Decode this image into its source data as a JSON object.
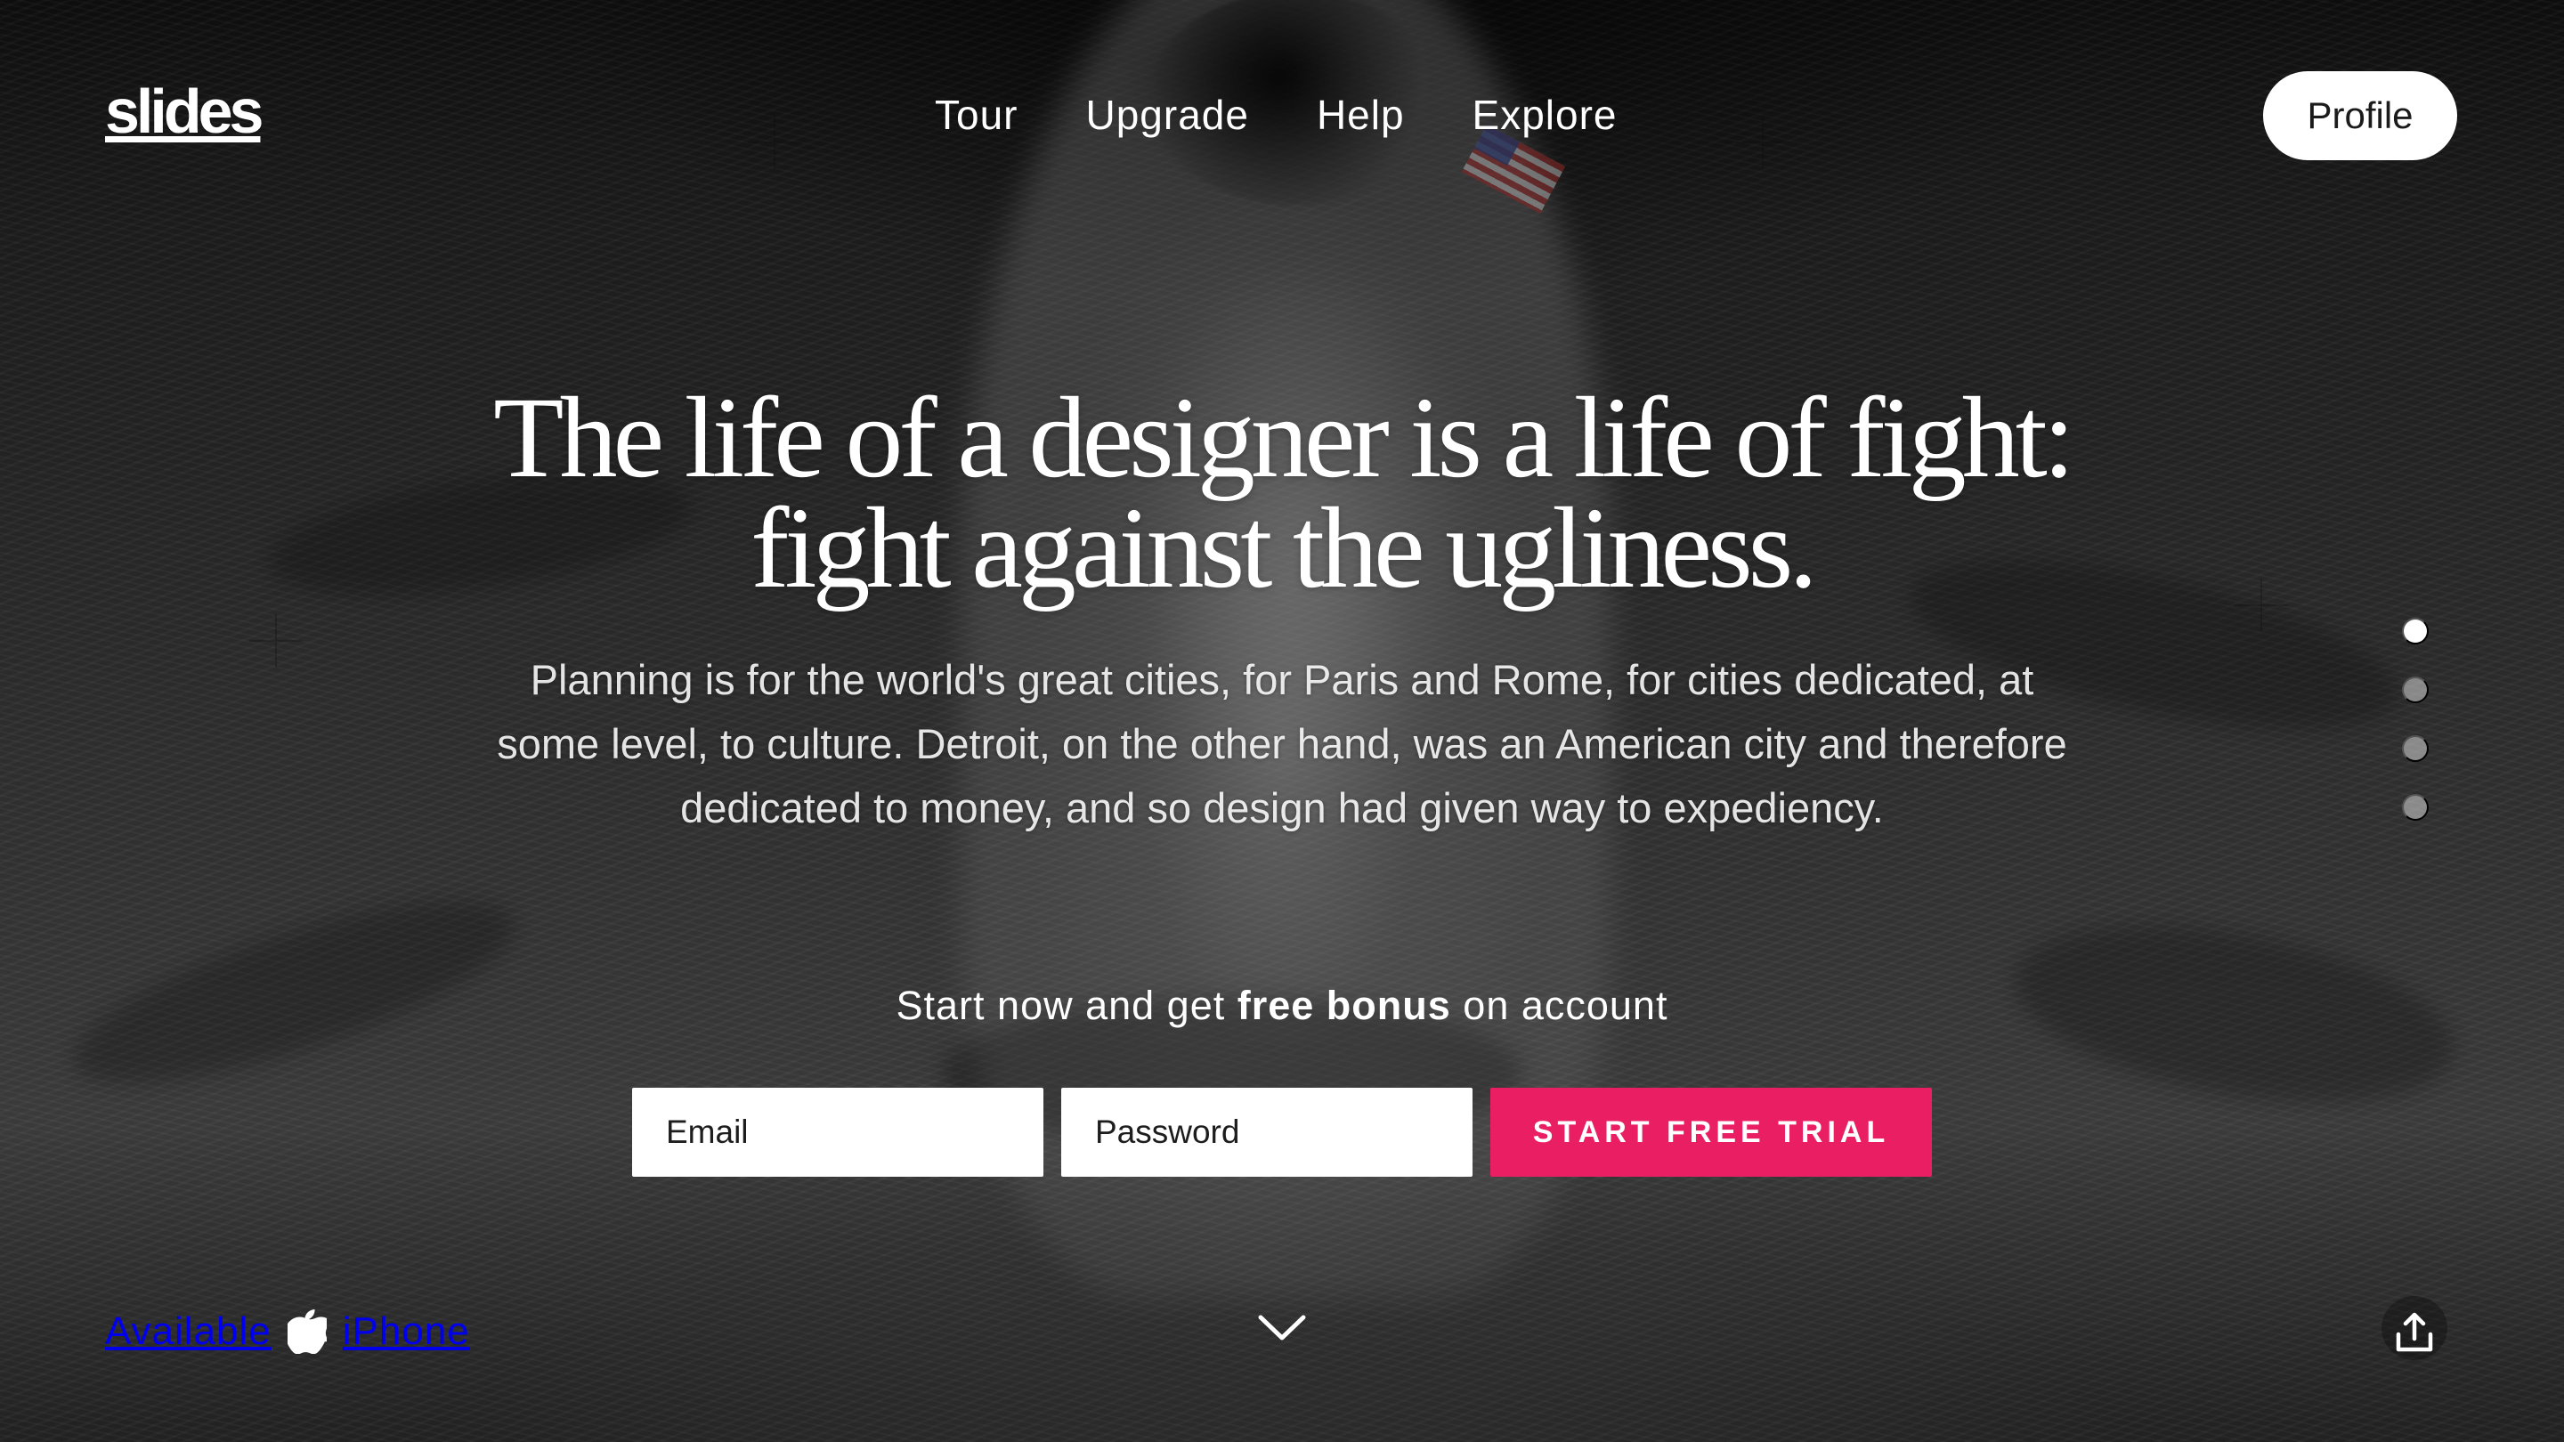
{
  "brand": {
    "name": "slides"
  },
  "navigation": {
    "items": [
      {
        "label": "Tour"
      },
      {
        "label": "Upgrade"
      },
      {
        "label": "Help"
      },
      {
        "label": "Explore"
      }
    ],
    "profile_label": "Profile"
  },
  "hero": {
    "headline_line_1": "The life of a designer is a life of fight:",
    "headline_line_2": "fight against the ugliness.",
    "description_line_1": "Planning is for the world's great cities, for Paris and Rome, for cities dedicated, at",
    "description_line_2": "some level, to culture. Detroit, on the other hand, was an American city and therefore",
    "description_line_3": "dedicated to money, and so design had given way to expediency."
  },
  "signup": {
    "prompt_prefix": "Start now and get ",
    "prompt_emphasis": "free bonus",
    "prompt_suffix": " on account",
    "email_placeholder": "Email",
    "password_placeholder": "Password",
    "trial_button": "START FREE TRIAL"
  },
  "slide_navigation": {
    "dots": [
      {
        "active": true
      },
      {
        "active": false
      },
      {
        "active": false
      },
      {
        "active": false
      }
    ]
  },
  "footer": {
    "available_label": "Available",
    "platform_label": "iPhone"
  },
  "icons": {
    "platform": "apple-icon",
    "scroll": "chevron-down-icon",
    "share": "share-icon"
  },
  "colors": {
    "accent": "#EA1E63",
    "profile_background": "#FFFFFF",
    "text": "#FFFFFF"
  }
}
